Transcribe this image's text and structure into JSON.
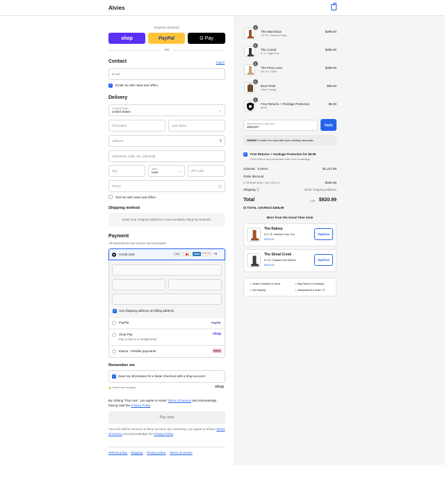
{
  "header": {
    "brand": "Alvies",
    "cart_icon": "shopping-bag-icon"
  },
  "express": {
    "label": "Express checkout",
    "shop_label": "shop",
    "paypal_label": "PayPal",
    "gpay_label": "G Pay",
    "or_label": "OR"
  },
  "contact": {
    "title": "Contact",
    "login_label": "Log in",
    "email_placeholder": "Email",
    "news_label": "Email me with news and offers"
  },
  "delivery": {
    "title": "Delivery",
    "country_label": "Country/Region",
    "country_value": "United States",
    "first_name": "First name",
    "last_name": "Last name",
    "address": "Address",
    "apartment": "Apartment, suite, etc. (optional)",
    "city": "City",
    "state_label": "State",
    "state_value": "Iowa",
    "zip": "ZIP code",
    "phone": "Phone",
    "text_label": "Text me with news and offers"
  },
  "shipping_method": {
    "title": "Shipping method",
    "note": "Enter your shipping address to view available shipping methods."
  },
  "payment": {
    "title": "Payment",
    "subtitle": "All transactions are secure and encrypted.",
    "credit_card": "Credit card",
    "card_logos": [
      "VISA",
      "MC",
      "AMEX",
      "DISCOVER",
      "+5"
    ],
    "billing_label": "Use shipping address as billing address",
    "paypal": "PayPal",
    "shop_pay": "Shop Pay",
    "shop_pay_sub": "Pay in full or in installments",
    "klarna": "Klarna - Flexible payments",
    "paypal_logo": "PayPal",
    "shop_logo": "shop",
    "klarna_logo": "Klarna."
  },
  "remember": {
    "title": "Remember me",
    "save_label": "Save my information for a faster checkout with a Shop account",
    "secure_label": "Secure and encrypted",
    "shop_logo": "shop"
  },
  "terms": {
    "prefix": "By clicking \"Pay now\", you agree to Alvies'",
    "tos": "Terms of Service",
    "middle": "and acknowledge having read the",
    "privacy": "Privacy Policy",
    "end": "."
  },
  "pay_now": "Pay now",
  "shop_notice": {
    "line1": "Your info will be saved to a Shop account. By continuing, you agree to Shop's",
    "tos": "Terms of Service",
    "middle": "and acknowledge the",
    "privacy": "Privacy Policy",
    "end": "."
  },
  "footer_links": [
    "Refund policy",
    "Shipping",
    "Privacy policy",
    "Terms of service"
  ],
  "cart": {
    "items": [
      {
        "qty": "1",
        "name": "The Manchaca",
        "variant": "9.5 / D / Grass of Poppy",
        "price": "$399.00",
        "color": "#a0522d"
      },
      {
        "qty": "1",
        "name": "The Comal",
        "variant": "8 / D / Night Fuel",
        "price": "$359.00",
        "color": "#3b3b3b"
      },
      {
        "qty": "1",
        "name": "The Perry Lane",
        "variant": "5.5 / B / Caster",
        "price": "$399.00",
        "color": "#c9a27a"
      },
      {
        "qty": "1",
        "name": "Boot Flask",
        "variant": "Green Thangs",
        "price": "$65.00",
        "color": "#6b4a2b"
      },
      {
        "qty": "1",
        "name": "Free Returns + Package Protection",
        "variant": "$5.99",
        "price": "$5.99",
        "color": "#111111"
      }
    ],
    "discount_label": "Discount code or gift card",
    "discount_value": "359GM7",
    "apply_label": "Apply",
    "discount_error_code": "359GM7",
    "discount_error_text": "couldn't be used with your existing discounts.",
    "protection_title": "Free Returns + Package Protection for $5.99",
    "protection_sub": "Free returns and protection from loss or damage",
    "subtotal_label": "Subtotal · 5 items",
    "subtotal_value": "$1,227.99",
    "order_discount_label": "Order discount",
    "discount_code": "SPEND $400, GET 25% O...",
    "discount_amount": "- $306.99",
    "shipping_label": "Shipping",
    "shipping_value": "Enter shipping address",
    "total_label": "Total",
    "currency": "USD",
    "total_value": "$920.99",
    "savings_label": "TOTAL SAVINGS",
    "savings_value": "$306.99",
    "more_title": "More from the Good-Time Aisle",
    "upsells": [
      {
        "name": "The Rainey",
        "variant": "5.5 / B / Marfa in the 70s",
        "price": "$299.00",
        "option": "Options",
        "color": "#a0522d"
      },
      {
        "name": "The Shoal Creek",
        "variant": "8 / D / Shaken Not Stirred",
        "price": "$359.00",
        "option": "Options",
        "color": "#3b3b3b"
      }
    ],
    "perks": [
      "Lifetime Guarantee on Boots",
      "Easy Returns & Exchanges",
      "Fast Shipping",
      "Headquartered in Austin, TX"
    ]
  },
  "colors": {
    "accent": "#2563eb",
    "shop": "#5a31f4",
    "paypal": "#ffc439",
    "gpay": "#000000",
    "klarna": "#ffb3c7"
  }
}
